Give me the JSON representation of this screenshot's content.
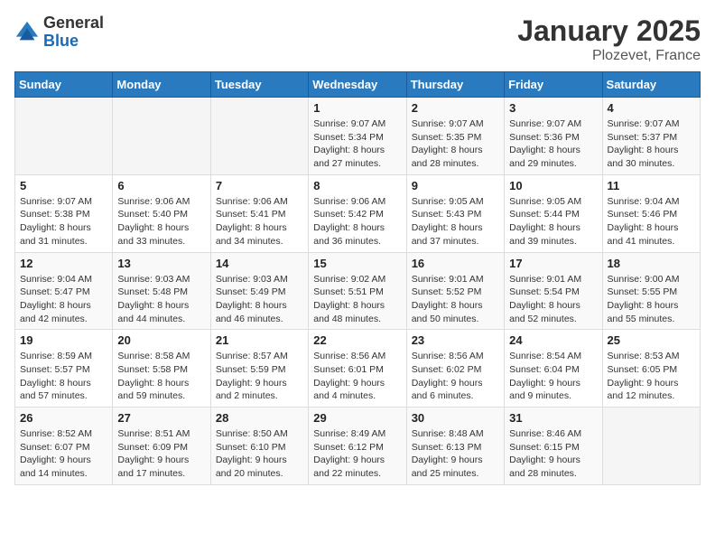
{
  "header": {
    "logo_general": "General",
    "logo_blue": "Blue",
    "month_title": "January 2025",
    "location": "Plozevet, France"
  },
  "weekdays": [
    "Sunday",
    "Monday",
    "Tuesday",
    "Wednesday",
    "Thursday",
    "Friday",
    "Saturday"
  ],
  "weeks": [
    [
      {
        "day": "",
        "info": ""
      },
      {
        "day": "",
        "info": ""
      },
      {
        "day": "",
        "info": ""
      },
      {
        "day": "1",
        "info": "Sunrise: 9:07 AM\nSunset: 5:34 PM\nDaylight: 8 hours and 27 minutes."
      },
      {
        "day": "2",
        "info": "Sunrise: 9:07 AM\nSunset: 5:35 PM\nDaylight: 8 hours and 28 minutes."
      },
      {
        "day": "3",
        "info": "Sunrise: 9:07 AM\nSunset: 5:36 PM\nDaylight: 8 hours and 29 minutes."
      },
      {
        "day": "4",
        "info": "Sunrise: 9:07 AM\nSunset: 5:37 PM\nDaylight: 8 hours and 30 minutes."
      }
    ],
    [
      {
        "day": "5",
        "info": "Sunrise: 9:07 AM\nSunset: 5:38 PM\nDaylight: 8 hours and 31 minutes."
      },
      {
        "day": "6",
        "info": "Sunrise: 9:06 AM\nSunset: 5:40 PM\nDaylight: 8 hours and 33 minutes."
      },
      {
        "day": "7",
        "info": "Sunrise: 9:06 AM\nSunset: 5:41 PM\nDaylight: 8 hours and 34 minutes."
      },
      {
        "day": "8",
        "info": "Sunrise: 9:06 AM\nSunset: 5:42 PM\nDaylight: 8 hours and 36 minutes."
      },
      {
        "day": "9",
        "info": "Sunrise: 9:05 AM\nSunset: 5:43 PM\nDaylight: 8 hours and 37 minutes."
      },
      {
        "day": "10",
        "info": "Sunrise: 9:05 AM\nSunset: 5:44 PM\nDaylight: 8 hours and 39 minutes."
      },
      {
        "day": "11",
        "info": "Sunrise: 9:04 AM\nSunset: 5:46 PM\nDaylight: 8 hours and 41 minutes."
      }
    ],
    [
      {
        "day": "12",
        "info": "Sunrise: 9:04 AM\nSunset: 5:47 PM\nDaylight: 8 hours and 42 minutes."
      },
      {
        "day": "13",
        "info": "Sunrise: 9:03 AM\nSunset: 5:48 PM\nDaylight: 8 hours and 44 minutes."
      },
      {
        "day": "14",
        "info": "Sunrise: 9:03 AM\nSunset: 5:49 PM\nDaylight: 8 hours and 46 minutes."
      },
      {
        "day": "15",
        "info": "Sunrise: 9:02 AM\nSunset: 5:51 PM\nDaylight: 8 hours and 48 minutes."
      },
      {
        "day": "16",
        "info": "Sunrise: 9:01 AM\nSunset: 5:52 PM\nDaylight: 8 hours and 50 minutes."
      },
      {
        "day": "17",
        "info": "Sunrise: 9:01 AM\nSunset: 5:54 PM\nDaylight: 8 hours and 52 minutes."
      },
      {
        "day": "18",
        "info": "Sunrise: 9:00 AM\nSunset: 5:55 PM\nDaylight: 8 hours and 55 minutes."
      }
    ],
    [
      {
        "day": "19",
        "info": "Sunrise: 8:59 AM\nSunset: 5:57 PM\nDaylight: 8 hours and 57 minutes."
      },
      {
        "day": "20",
        "info": "Sunrise: 8:58 AM\nSunset: 5:58 PM\nDaylight: 8 hours and 59 minutes."
      },
      {
        "day": "21",
        "info": "Sunrise: 8:57 AM\nSunset: 5:59 PM\nDaylight: 9 hours and 2 minutes."
      },
      {
        "day": "22",
        "info": "Sunrise: 8:56 AM\nSunset: 6:01 PM\nDaylight: 9 hours and 4 minutes."
      },
      {
        "day": "23",
        "info": "Sunrise: 8:56 AM\nSunset: 6:02 PM\nDaylight: 9 hours and 6 minutes."
      },
      {
        "day": "24",
        "info": "Sunrise: 8:54 AM\nSunset: 6:04 PM\nDaylight: 9 hours and 9 minutes."
      },
      {
        "day": "25",
        "info": "Sunrise: 8:53 AM\nSunset: 6:05 PM\nDaylight: 9 hours and 12 minutes."
      }
    ],
    [
      {
        "day": "26",
        "info": "Sunrise: 8:52 AM\nSunset: 6:07 PM\nDaylight: 9 hours and 14 minutes."
      },
      {
        "day": "27",
        "info": "Sunrise: 8:51 AM\nSunset: 6:09 PM\nDaylight: 9 hours and 17 minutes."
      },
      {
        "day": "28",
        "info": "Sunrise: 8:50 AM\nSunset: 6:10 PM\nDaylight: 9 hours and 20 minutes."
      },
      {
        "day": "29",
        "info": "Sunrise: 8:49 AM\nSunset: 6:12 PM\nDaylight: 9 hours and 22 minutes."
      },
      {
        "day": "30",
        "info": "Sunrise: 8:48 AM\nSunset: 6:13 PM\nDaylight: 9 hours and 25 minutes."
      },
      {
        "day": "31",
        "info": "Sunrise: 8:46 AM\nSunset: 6:15 PM\nDaylight: 9 hours and 28 minutes."
      },
      {
        "day": "",
        "info": ""
      }
    ]
  ]
}
